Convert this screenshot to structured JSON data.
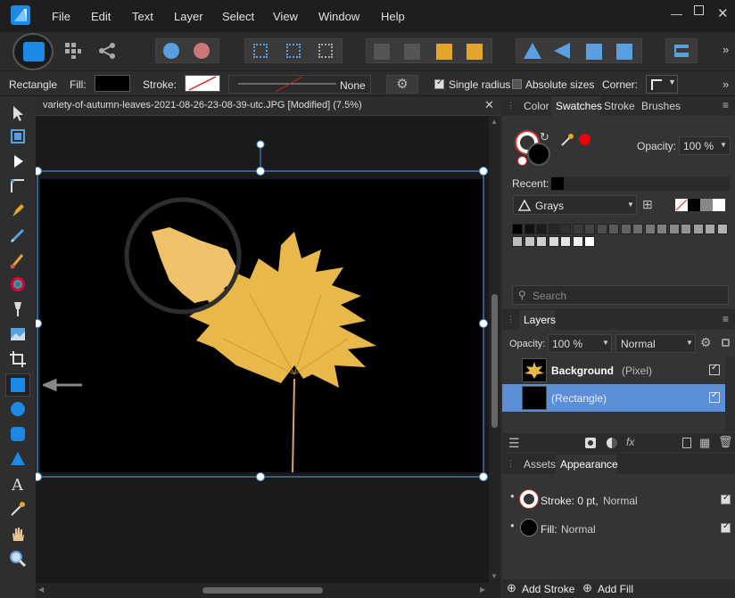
{
  "menubar": {
    "items": [
      "File",
      "Edit",
      "Text",
      "Layer",
      "Select",
      "View",
      "Window",
      "Help"
    ]
  },
  "context": {
    "tool_name": "Rectangle",
    "fill_label": "Fill:",
    "stroke_label": "Stroke:",
    "stroke_style": "None",
    "single_radius_label": "Single radius",
    "absolute_sizes_label": "Absolute sizes",
    "corner_label": "Corner:"
  },
  "document": {
    "tab_title": "variety-of-autumn-leaves-2021-08-26-23-08-39-utc.JPG [Modified] (7.5%)"
  },
  "swatches_panel": {
    "tabs": [
      "Color",
      "Swatches",
      "Stroke",
      "Brushes"
    ],
    "opacity_label": "Opacity:",
    "opacity_value": "100 %",
    "recent_label": "Recent:",
    "palette_name": "Grays",
    "search_placeholder": "Search",
    "grays": [
      "#000000",
      "#111111",
      "#1c1c1c",
      "#262626",
      "#303030",
      "#3a3a3a",
      "#444444",
      "#4e4e4e",
      "#585858",
      "#626262",
      "#6c6c6c",
      "#767676",
      "#808080",
      "#8a8a8a",
      "#949494",
      "#9e9e9e",
      "#a8a8a8",
      "#b2b2b2",
      "#bcbcbc",
      "#c6c6c6",
      "#d0d0d0",
      "#dadada",
      "#e4e4e4",
      "#eeeeee",
      "#ffffff"
    ]
  },
  "layers_panel": {
    "title": "Layers",
    "opacity_label": "Opacity:",
    "opacity_value": "100 %",
    "blend_mode": "Normal",
    "layers": [
      {
        "name": "Background",
        "type": "(Pixel)"
      },
      {
        "name": "",
        "type": "(Rectangle)"
      }
    ]
  },
  "appearance_panel": {
    "tabs": [
      "Assets",
      "Appearance"
    ],
    "stroke_label": "Stroke: 0 pt,",
    "stroke_mode": "Normal",
    "fill_label": "Fill:",
    "fill_mode": "Normal",
    "add_stroke": "Add Stroke",
    "add_fill": "Add Fill"
  },
  "colors": {
    "accent": "#4a90d9",
    "selection_row": "#5b8fd6",
    "app_blue": "#1e88e5",
    "leaf": "#e8b84a"
  }
}
